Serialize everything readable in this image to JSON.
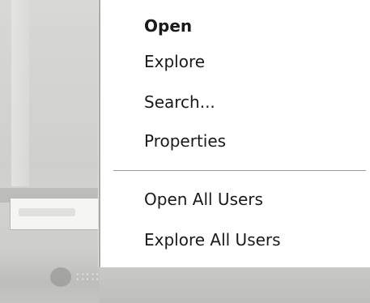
{
  "context_menu": {
    "items": [
      {
        "label": "Open",
        "default": true
      },
      {
        "label": "Explore",
        "default": false
      },
      {
        "label": "Search...",
        "default": false
      },
      {
        "label": "Properties",
        "default": false
      },
      {
        "label": "Open All Users",
        "default": false
      },
      {
        "label": "Explore All Users",
        "default": false
      }
    ]
  },
  "colors": {
    "menu_background": "#ffffff",
    "menu_text": "#1a1a1a",
    "separator": "#9c9c9a",
    "backdrop": "#d0d0ce"
  }
}
